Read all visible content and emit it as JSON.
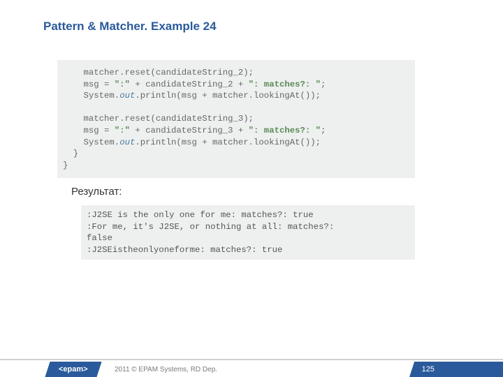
{
  "title": "Pattern & Matcher. Example 24",
  "code": {
    "l1a": "    matcher.reset(candidateString_2);",
    "l2a": "    msg = ",
    "l2b": "\":\"",
    "l2c": " + candidateString_2 + ",
    "l2d": "\": matches?: \"",
    "l2e": ";",
    "l3a": "    System.",
    "l3b": "out",
    "l3c": ".println(msg + matcher.lookingAt());",
    "blank": "",
    "l5a": "    matcher.reset(candidateString_3);",
    "l6a": "    msg = ",
    "l6b": "\":\"",
    "l6c": " + candidateString_3 + ",
    "l6d": "\": matches?: \"",
    "l6e": ";",
    "l7a": "    System.",
    "l7b": "out",
    "l7c": ".println(msg + matcher.lookingAt());",
    "l8": "  }",
    "l9": "}"
  },
  "result_label": "Результат:",
  "output": {
    "o1": ":J2SE is the only one for me: matches?: true",
    "o2": ":For me, it's J2SE, or nothing at all: matches?:",
    "o3": "false",
    "o4": ":J2SEistheonlyoneforme: matches?: true"
  },
  "footer": {
    "logo": "<epam>",
    "copy": "2011 © EPAM Systems, RD Dep.",
    "page": "125"
  }
}
